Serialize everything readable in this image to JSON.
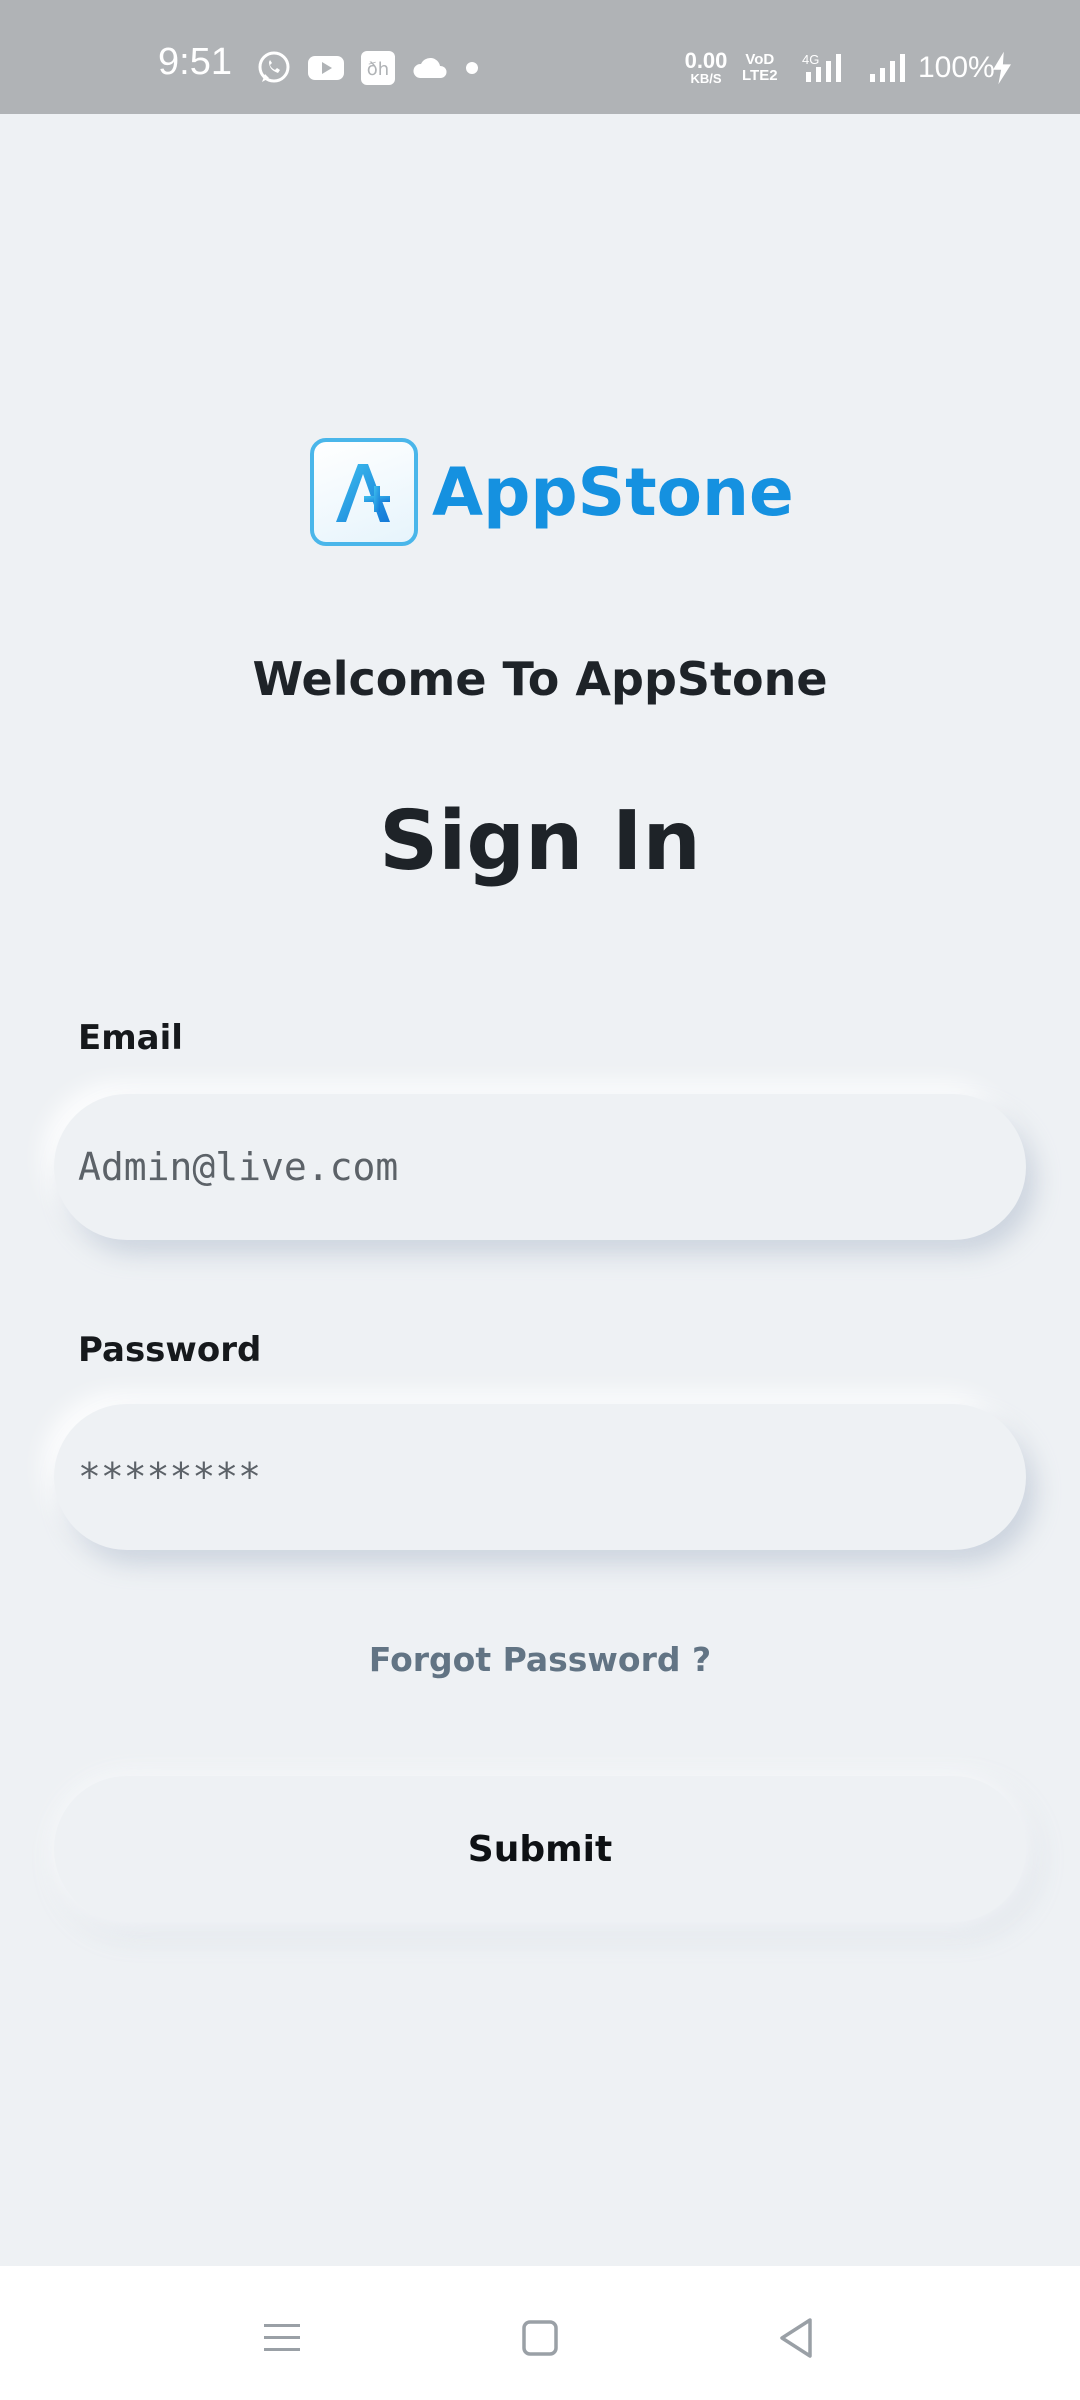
{
  "status_bar": {
    "time": "9:51",
    "icons": [
      "whatsapp-icon",
      "youtube-icon",
      "app-icon",
      "cloud-icon",
      "dot-icon"
    ],
    "net_speed_value": "0.00",
    "net_speed_unit": "KB/S",
    "volte_top": "VoD",
    "volte_bottom": "LTE2",
    "network": "4G",
    "battery": "100%"
  },
  "brand": {
    "name": "AppStone",
    "color": "#1591e0"
  },
  "welcome": "Welcome To AppStone",
  "title": "Sign In",
  "form": {
    "email_label": "Email",
    "email_value": "Admin@live.com",
    "password_label": "Password",
    "password_value": "********",
    "forgot_link": "Forgot Password ?",
    "submit_label": "Submit"
  },
  "nav": [
    "menu-icon",
    "home-icon",
    "back-icon"
  ],
  "colors": {
    "background": "#eef1f4",
    "status_bar": "#b0b3b6",
    "link": "#627484"
  }
}
